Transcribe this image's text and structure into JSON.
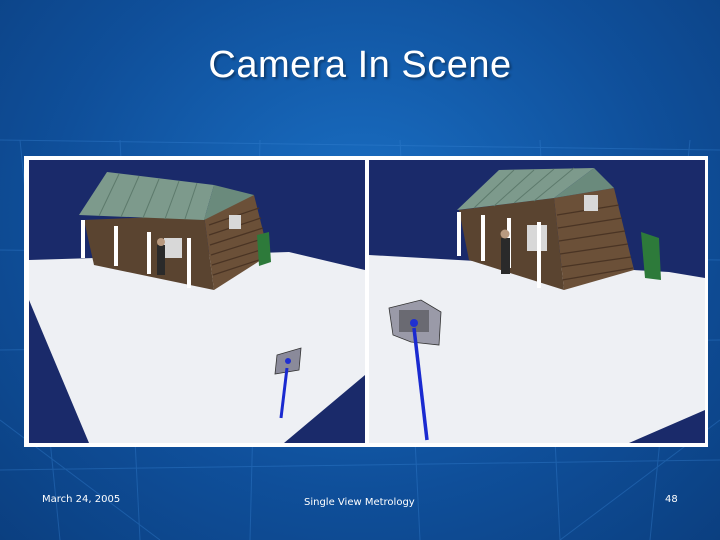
{
  "slide": {
    "title": "Camera In Scene",
    "footer_date": "March 24, 2005",
    "footer_title": "Single View Metrology",
    "page_number": "48"
  },
  "colors": {
    "background": "#1460b0",
    "panel_border": "#ffffff",
    "scene_sky": "#1a2a6a",
    "ground": "#eef0f4",
    "roof": "#7d9a8c",
    "wall": "#6b5038",
    "camera_path": "#1a2ad0"
  },
  "images": [
    {
      "label": "left-view",
      "depicts": "3D reconstructed cottage with small camera marker in foreground"
    },
    {
      "label": "right-view",
      "depicts": "3D reconstructed cottage with camera image plane and blue camera path"
    }
  ]
}
